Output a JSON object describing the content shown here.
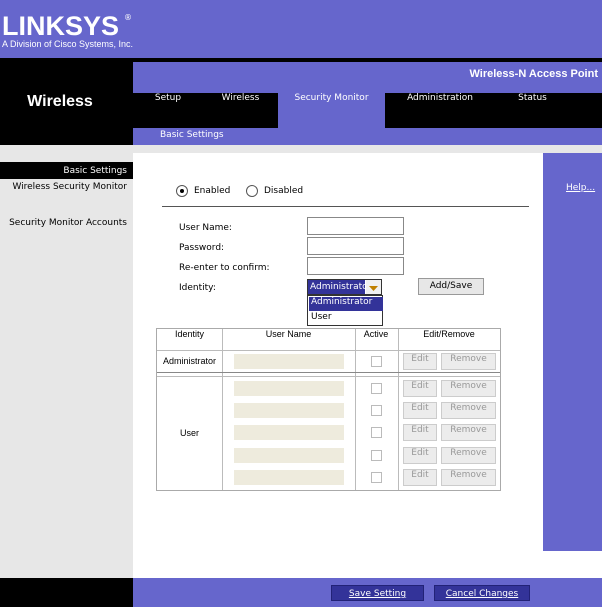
{
  "brand": {
    "name": "LINKSYS",
    "tagline": "A Division of Cisco Systems, Inc.",
    "registered": "®"
  },
  "section_title": "Wireless",
  "product_name": "Wireless-N Access Point",
  "tabs": [
    {
      "label": "Setup"
    },
    {
      "label": "Wireless"
    },
    {
      "label": "Security Monitor"
    },
    {
      "label": "Administration"
    },
    {
      "label": "Status"
    }
  ],
  "subnav": {
    "label": "Basic Settings"
  },
  "left_menu": [
    "Basic Settings",
    "Wireless Security Monitor",
    "Security Monitor Accounts"
  ],
  "help_link": "Help...",
  "form": {
    "enabled_label": "Enabled",
    "disabled_label": "Disabled",
    "username_label": "User Name:",
    "password_label": "Password:",
    "reenter_label": "Re-enter to confirm:",
    "identity_label": "Identity:",
    "identity_value": "Administrator",
    "identity_options": [
      "Administrator",
      "User"
    ],
    "add_save_label": "Add/Save"
  },
  "table": {
    "headers": [
      "Identity",
      "User Name",
      "Active",
      "Edit/Remove"
    ],
    "admin_label": "Administrator",
    "user_label": "User",
    "edit_label": "Edit",
    "remove_label": "Remove"
  },
  "footer": {
    "save_label": "Save Setting",
    "cancel_label": "Cancel Changes"
  }
}
